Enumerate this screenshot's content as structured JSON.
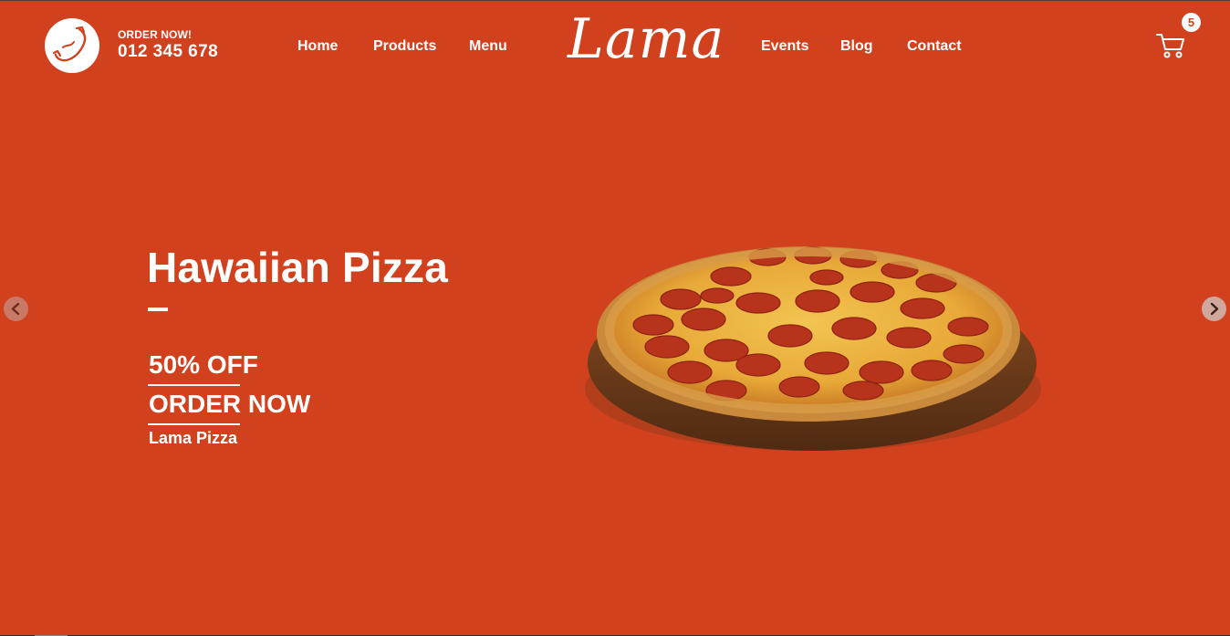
{
  "header": {
    "order_label": "ORDER NOW!",
    "phone_number": "012 345 678",
    "nav_left": [
      "Home",
      "Products",
      "Menu"
    ],
    "logo_text": "Lama",
    "nav_right": [
      "Events",
      "Blog",
      "Contact"
    ],
    "cart_count": "5"
  },
  "hero": {
    "title": "Hawaiian Pizza",
    "offer": "50% OFF",
    "cta": "ORDER NOW",
    "subtitle": "Lama Pizza"
  },
  "icons": {
    "phone": "phone-icon",
    "cart": "cart-icon",
    "prev": "chevron-left-icon",
    "next": "chevron-right-icon"
  },
  "colors": {
    "background": "#d1411e",
    "text": "#ffffff"
  }
}
